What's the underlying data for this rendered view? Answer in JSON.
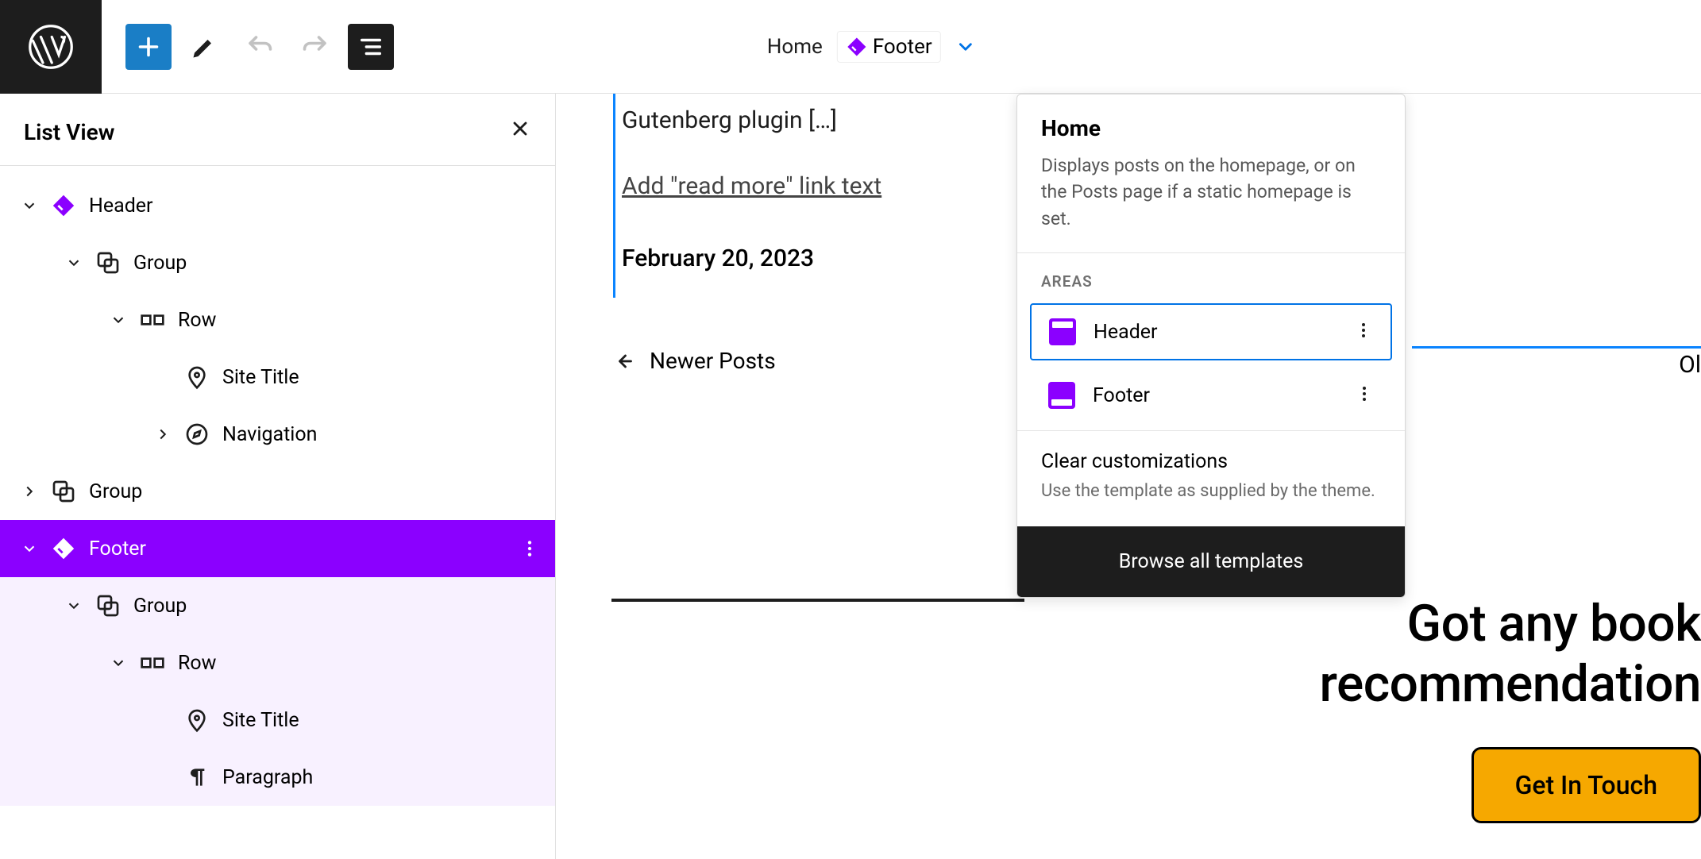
{
  "breadcrumb": {
    "home": "Home",
    "footer": "Footer"
  },
  "listview": {
    "title": "List View",
    "items": {
      "header": "Header",
      "group1": "Group",
      "row1": "Row",
      "siteTitle1": "Site Title",
      "navigation": "Navigation",
      "group2": "Group",
      "footer": "Footer",
      "group3": "Group",
      "row2": "Row",
      "siteTitle2": "Site Title",
      "paragraph": "Paragraph"
    }
  },
  "canvas": {
    "postTitle": "Gutenberg plugin […]",
    "readMore": "Add \"read more\" link text",
    "postDate": "February 20, 2023",
    "newerPosts": "Newer Posts",
    "olderSnippet": "Ol",
    "chatLine1": "Got any book",
    "chatLine2": "recommendation",
    "getInTouch": "Get In Touch"
  },
  "dropdown": {
    "title": "Home",
    "desc": "Displays posts on the homepage, or on the Posts page if a static homepage is set.",
    "areasLabel": "AREAS",
    "areaHeader": "Header",
    "areaFooter": "Footer",
    "clearTitle": "Clear customizations",
    "clearDesc": "Use the template as supplied by the theme.",
    "browse": "Browse all templates"
  }
}
